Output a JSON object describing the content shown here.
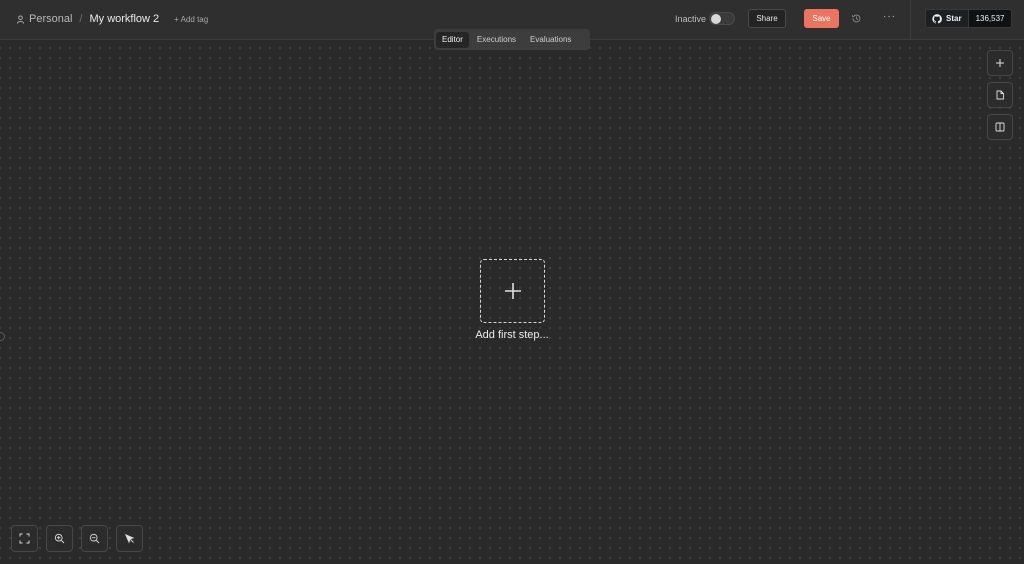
{
  "header": {
    "project_label": "Personal",
    "separator": "/",
    "workflow_name": "My workflow 2",
    "add_tag_label": "+ Add tag",
    "active_status_label": "Inactive",
    "active_toggle_on": false,
    "share_label": "Share",
    "save_label": "Save",
    "more_label": "···",
    "github": {
      "star_label": "Star",
      "star_count": "136,537"
    }
  },
  "tabs": [
    {
      "label": "Editor",
      "active": true
    },
    {
      "label": "Executions",
      "active": false
    },
    {
      "label": "Evaluations",
      "active": false
    }
  ],
  "canvas": {
    "add_first_step_label": "Add first step..."
  },
  "side_tools": [
    {
      "icon": "plus-icon",
      "name": "add-node-button"
    },
    {
      "icon": "sticky-note-icon",
      "name": "add-sticky-button"
    },
    {
      "icon": "panel-icon",
      "name": "toggle-panel-button"
    }
  ],
  "zoom_tools": [
    {
      "icon": "fit-view-icon",
      "name": "fit-view-button"
    },
    {
      "icon": "zoom-in-icon",
      "name": "zoom-in-button"
    },
    {
      "icon": "zoom-out-icon",
      "name": "zoom-out-button"
    },
    {
      "icon": "pointer-icon",
      "name": "pointer-button"
    }
  ],
  "colors": {
    "save_accent": "#ea7462",
    "canvas_bg": "#2a2a2a",
    "topbar_bg": "#2f2f2f"
  }
}
